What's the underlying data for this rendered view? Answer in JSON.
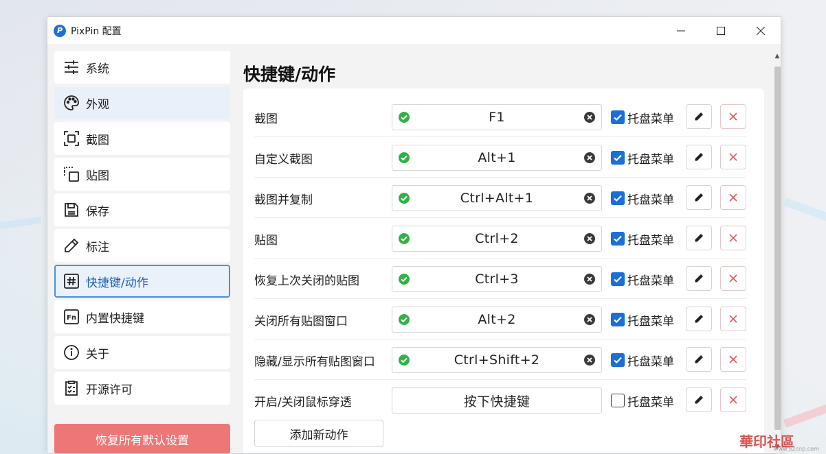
{
  "window": {
    "title": "PixPin 配置",
    "app_icon_letter": "P"
  },
  "sidebar": {
    "items": [
      {
        "label": "系统",
        "icon": "sliders-icon"
      },
      {
        "label": "外观",
        "icon": "palette-icon"
      },
      {
        "label": "截图",
        "icon": "screenshot-icon"
      },
      {
        "label": "贴图",
        "icon": "pin-copy-icon"
      },
      {
        "label": "保存",
        "icon": "save-icon"
      },
      {
        "label": "标注",
        "icon": "pencil-icon"
      },
      {
        "label": "快捷键/动作",
        "icon": "hash-icon",
        "active": true
      },
      {
        "label": "内置快捷键",
        "icon": "fn-key-icon",
        "icon_text": "Fn"
      },
      {
        "label": "关于",
        "icon": "info-icon"
      },
      {
        "label": "开源许可",
        "icon": "checklist-icon"
      }
    ],
    "reset_label": "恢复所有默认设置"
  },
  "main": {
    "title": "快捷键/动作",
    "tray_label": "托盘菜单",
    "rows": [
      {
        "label": "截图",
        "hotkey": "F1",
        "ok": true,
        "tray": true
      },
      {
        "label": "自定义截图",
        "hotkey": "Alt+1",
        "ok": true,
        "tray": true
      },
      {
        "label": "截图并复制",
        "hotkey": "Ctrl+Alt+1",
        "ok": true,
        "tray": true
      },
      {
        "label": "贴图",
        "hotkey": "Ctrl+2",
        "ok": true,
        "tray": true
      },
      {
        "label": "恢复上次关闭的贴图",
        "hotkey": "Ctrl+3",
        "ok": true,
        "tray": true
      },
      {
        "label": "关闭所有贴图窗口",
        "hotkey": "Alt+2",
        "ok": true,
        "tray": true
      },
      {
        "label": "隐藏/显示所有贴图窗口",
        "hotkey": "Ctrl+Shift+2",
        "ok": true,
        "tray": true
      },
      {
        "label": "开启/关闭鼠标穿透",
        "hotkey": "按下快捷键",
        "ok": false,
        "tray": false
      }
    ],
    "add_label": "添加新动作"
  },
  "watermark": {
    "text": "華印社區",
    "sub": "www.52cnp.com"
  },
  "colors": {
    "accent": "#1c6fd6",
    "ok": "#2fb344",
    "danger": "#ef7676",
    "active_border": "#4a8fdc"
  }
}
